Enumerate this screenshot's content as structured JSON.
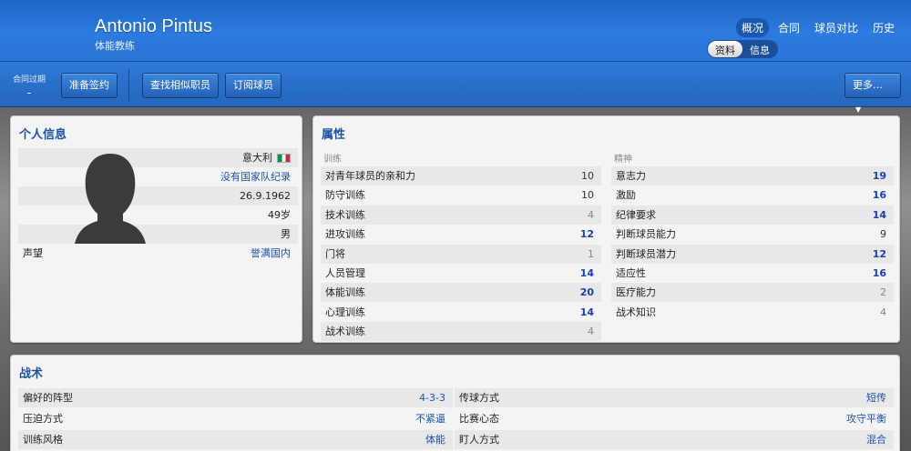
{
  "header": {
    "name": "Antonio Pintus",
    "role": "体能教练",
    "tabs": [
      "概况",
      "合同",
      "球员对比",
      "历史"
    ],
    "active_tab": "概况",
    "subtabs": [
      "资料",
      "信息"
    ],
    "active_subtab": "资料"
  },
  "toolbar": {
    "contract_label": "合同过期",
    "contract_value": "-",
    "btn_prepare": "准备签约",
    "btn_find_similar": "查找相似职员",
    "btn_subscribe": "订阅球员",
    "btn_more": "更多…"
  },
  "personal": {
    "title": "个人信息",
    "nationality": "意大利",
    "national_team": "没有国家队纪录",
    "birthdate": "26.9.1962",
    "age": "49岁",
    "gender": "男",
    "reputation_label": "声望",
    "reputation_value": "誉满国内",
    "flag_colors": [
      "#009246",
      "#ffffff",
      "#ce2b37"
    ]
  },
  "attributes": {
    "title": "属性",
    "training_label": "训练",
    "mental_label": "精神",
    "training": [
      {
        "name": "对青年球员的亲和力",
        "value": "10"
      },
      {
        "name": "防守训练",
        "value": "10"
      },
      {
        "name": "技术训练",
        "value": "4"
      },
      {
        "name": "进攻训练",
        "value": "12"
      },
      {
        "name": "门将",
        "value": "1"
      },
      {
        "name": "人员管理",
        "value": "14"
      },
      {
        "name": "体能训练",
        "value": "20"
      },
      {
        "name": "心理训练",
        "value": "14"
      },
      {
        "name": "战术训练",
        "value": "4"
      }
    ],
    "mental": [
      {
        "name": "意志力",
        "value": "19"
      },
      {
        "name": "激励",
        "value": "16"
      },
      {
        "name": "纪律要求",
        "value": "14"
      },
      {
        "name": "判断球员能力",
        "value": "9"
      },
      {
        "name": "判断球员潜力",
        "value": "12"
      },
      {
        "name": "适应性",
        "value": "16"
      },
      {
        "name": "医疗能力",
        "value": "2"
      },
      {
        "name": "战术知识",
        "value": "4"
      }
    ]
  },
  "tactics": {
    "title": "战术",
    "left": [
      {
        "name": "偏好的阵型",
        "value": "4-3-3"
      },
      {
        "name": "压迫方式",
        "value": "不紧逼"
      },
      {
        "name": "训练风格",
        "value": "体能"
      }
    ],
    "right": [
      {
        "name": "传球方式",
        "value": "短传"
      },
      {
        "name": "比赛心态",
        "value": "攻守平衡"
      },
      {
        "name": "盯人方式",
        "value": "混合"
      }
    ]
  }
}
